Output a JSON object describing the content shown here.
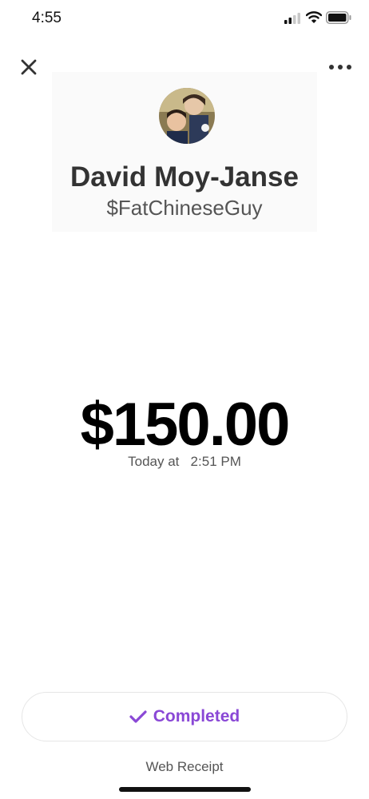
{
  "status_bar": {
    "time": "4:55",
    "icons": [
      "signal-icon",
      "wifi-icon",
      "battery-icon"
    ]
  },
  "header": {
    "close_icon": "close-icon",
    "more_icon": "more-horizontal-icon"
  },
  "profile": {
    "name": "David Moy-Janse",
    "cashtag": "$FatChineseGuy"
  },
  "payment": {
    "amount": "$150.00",
    "timestamp": "Today at   2:51 PM"
  },
  "status": {
    "label": "Completed",
    "icon": "check-icon",
    "color": "#8a48d6"
  },
  "footer": {
    "web_receipt": "Web Receipt"
  }
}
